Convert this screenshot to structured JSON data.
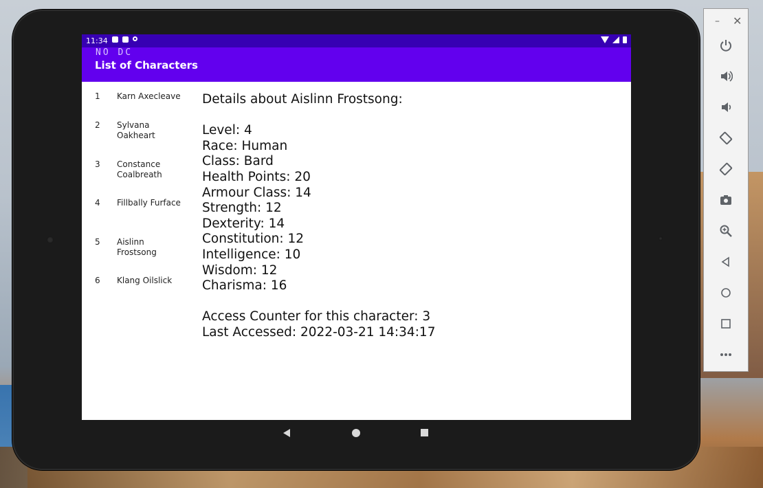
{
  "status": {
    "time": "11:34"
  },
  "appbar": {
    "debug_text": "NO DC",
    "title": "List of Characters"
  },
  "characters": [
    {
      "num": "1",
      "name": "Karn Axecleave"
    },
    {
      "num": "2",
      "name": "Sylvana Oakheart"
    },
    {
      "num": "3",
      "name": "Constance Coalbreath"
    },
    {
      "num": "4",
      "name": "Fillbally Furface"
    },
    {
      "num": "5",
      "name": "Aislinn Frostsong"
    },
    {
      "num": "6",
      "name": "Klang Oilslick"
    }
  ],
  "details": {
    "heading": "Details about Aislinn Frostsong:",
    "level": "Level: 4",
    "race": "Race: Human",
    "class": "Class: Bard",
    "health": "Health Points: 20",
    "armour": "Armour Class: 14",
    "strength": "Strength: 12",
    "dexterity": "Dexterity: 14",
    "constitution": "Constitution: 12",
    "intelligence": "Intelligence: 10",
    "wisdom": "Wisdom: 12",
    "charisma": "Charisma: 16",
    "access_counter": "Access Counter for this character: 3",
    "last_accessed": "Last Accessed: 2022-03-21 14:34:17"
  },
  "toolbar": {
    "minimize": "–",
    "close": "✕",
    "icons": [
      "power-icon",
      "volume-up-icon",
      "volume-down-icon",
      "rotate-left-icon",
      "rotate-right-icon",
      "camera-icon",
      "zoom-icon",
      "back-icon",
      "home-icon",
      "overview-icon",
      "more-icon"
    ]
  }
}
